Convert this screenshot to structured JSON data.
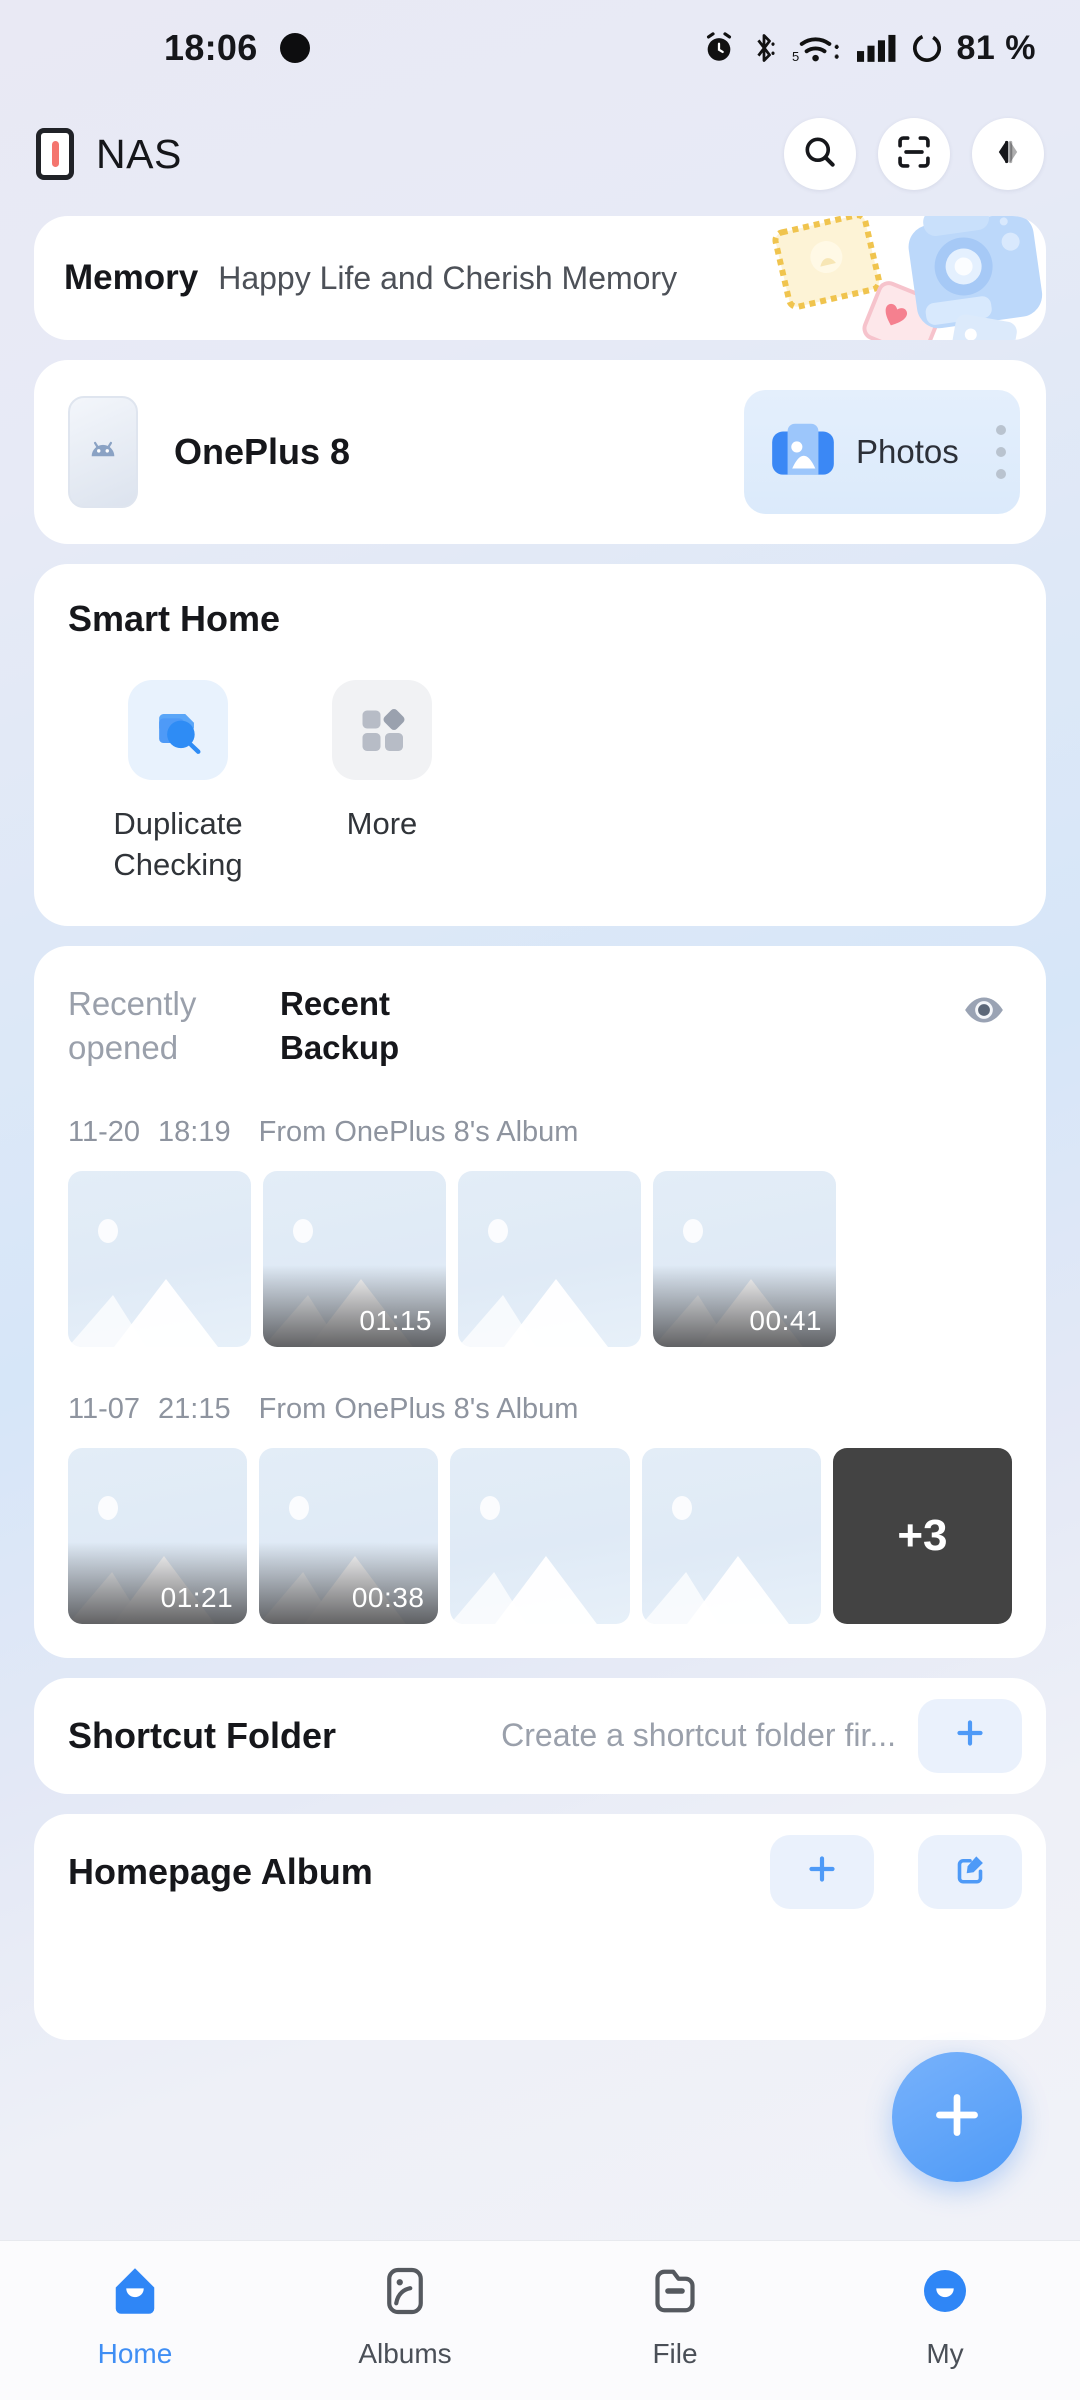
{
  "status_bar": {
    "time": "18:06",
    "battery_percent": "81 %",
    "icons": [
      "alarm-icon",
      "bluetooth-icon",
      "wifi-5g-icon",
      "signal-bars-icon",
      "battery-ring-icon"
    ]
  },
  "app_bar": {
    "title": "NAS",
    "logo_icon": "nas-phone-icon",
    "actions": [
      {
        "name": "search-button",
        "icon": "search-icon"
      },
      {
        "name": "scan-button",
        "icon": "scan-frame-icon"
      },
      {
        "name": "transfer-button",
        "icon": "transfer-arrows-icon"
      }
    ]
  },
  "memory": {
    "title": "Memory",
    "subtitle": "Happy Life and Cherish Memory",
    "art_icon": "memory-camera-illustration"
  },
  "device": {
    "name": "OnePlus 8",
    "device_icon": "android-phone-icon",
    "chip_label": "Photos",
    "chip_icon": "photos-app-icon",
    "chip_menu_icon": "more-dots-icon"
  },
  "smart_home": {
    "title": "Smart Home",
    "items": [
      {
        "label": "Duplicate Checking",
        "icon": "duplicate-search-icon"
      },
      {
        "label": "More",
        "icon": "grid-more-icon"
      }
    ]
  },
  "recent": {
    "tabs": [
      {
        "label": "Recently opened",
        "active": false
      },
      {
        "label": "Recent Backup",
        "active": true
      }
    ],
    "eye_icon": "eye-icon",
    "groups": [
      {
        "date": "11-20",
        "time": "18:19",
        "source": "From OnePlus 8's Album",
        "items": [
          {
            "duration": ""
          },
          {
            "duration": "01:15"
          },
          {
            "duration": ""
          },
          {
            "duration": "00:41"
          }
        ],
        "overflow": ""
      },
      {
        "date": "11-07",
        "time": "21:15",
        "source": "From OnePlus 8's Album",
        "items": [
          {
            "duration": "01:21"
          },
          {
            "duration": "00:38"
          },
          {
            "duration": ""
          },
          {
            "duration": ""
          }
        ],
        "overflow": "+3"
      }
    ]
  },
  "shortcut_folder": {
    "title": "Shortcut Folder",
    "hint": "Create a shortcut folder fir...",
    "add_icon": "plus-icon"
  },
  "homepage_album": {
    "title": "Homepage Album",
    "add_icon": "plus-icon",
    "edit_icon": "edit-square-icon"
  },
  "fab": {
    "icon": "plus-icon"
  },
  "bottom_nav": {
    "items": [
      {
        "label": "Home",
        "icon": "home-icon",
        "active": true
      },
      {
        "label": "Albums",
        "icon": "albums-icon",
        "active": false
      },
      {
        "label": "File",
        "icon": "file-icon",
        "active": false
      },
      {
        "label": "My",
        "icon": "my-icon",
        "active": false
      }
    ]
  },
  "colors": {
    "accent": "#4e9af7",
    "active_nav": "#3f8ef4",
    "overflow_tile": "#434343",
    "muted_text": "#9aa0ab"
  }
}
